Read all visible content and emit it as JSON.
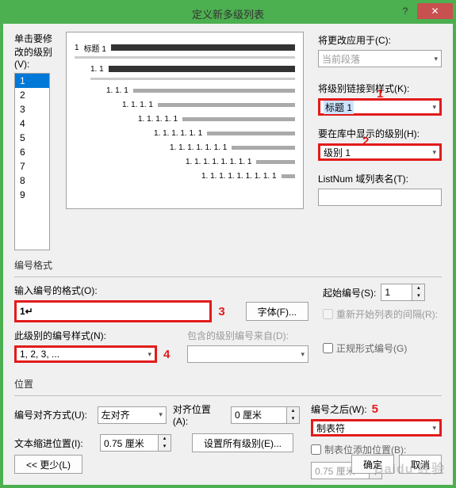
{
  "title": "定义新多级列表",
  "labels": {
    "level_to_modify": "单击要修改的级别(V):",
    "apply_to": "将更改应用于(C):",
    "apply_to_value": "当前段落",
    "link_style": "将级别链接到样式(K):",
    "link_style_value": "标题 1",
    "show_in_gallery": "要在库中显示的级别(H):",
    "show_in_gallery_value": "级别 1",
    "listnum": "ListNum 域列表名(T):",
    "listnum_value": "",
    "format_group": "编号格式",
    "enter_format": "输入编号的格式(O):",
    "format_value": "1↵",
    "font_btn": "字体(F)...",
    "start_at": "起始编号(S):",
    "start_at_value": "1",
    "restart": "重新开始列表的间隔(R):",
    "restart_value": "",
    "number_style": "此级别的编号样式(N):",
    "number_style_value": "1, 2, 3, ...",
    "include_from": "包含的级别编号来自(D):",
    "include_value": "",
    "legal": "正规形式编号(G)",
    "position_group": "位置",
    "align": "编号对齐方式(U):",
    "align_value": "左对齐",
    "align_at": "对齐位置(A):",
    "align_at_value": "0 厘米",
    "follow": "编号之后(W):",
    "follow_value": "制表符",
    "indent": "文本缩进位置(I):",
    "indent_value": "0.75 厘米",
    "set_all": "设置所有级别(E)...",
    "tab_at": "制表位添加位置(B):",
    "tab_at_value": "0.75 厘米",
    "less": "<< 更少(L)",
    "ok": "确定",
    "cancel": "取消"
  },
  "levels": [
    "1",
    "2",
    "3",
    "4",
    "5",
    "6",
    "7",
    "8",
    "9"
  ],
  "preview": [
    {
      "num": "1",
      "label": "标题 1",
      "indent": 0,
      "thick": true
    },
    {
      "num": "1. 1",
      "indent": 20,
      "thick": true
    },
    {
      "num": "1. 1. 1",
      "indent": 40
    },
    {
      "num": "1. 1. 1. 1",
      "indent": 60
    },
    {
      "num": "1. 1. 1. 1. 1",
      "indent": 80
    },
    {
      "num": "1. 1. 1. 1. 1. 1",
      "indent": 100
    },
    {
      "num": "1. 1. 1. 1. 1. 1. 1",
      "indent": 120
    },
    {
      "num": "1. 1. 1. 1. 1. 1. 1. 1",
      "indent": 140
    },
    {
      "num": "1. 1. 1. 1. 1. 1. 1. 1. 1",
      "indent": 160
    }
  ],
  "annotations": {
    "a1": "1",
    "a2": "2",
    "a3": "3",
    "a4": "4",
    "a5": "5"
  }
}
